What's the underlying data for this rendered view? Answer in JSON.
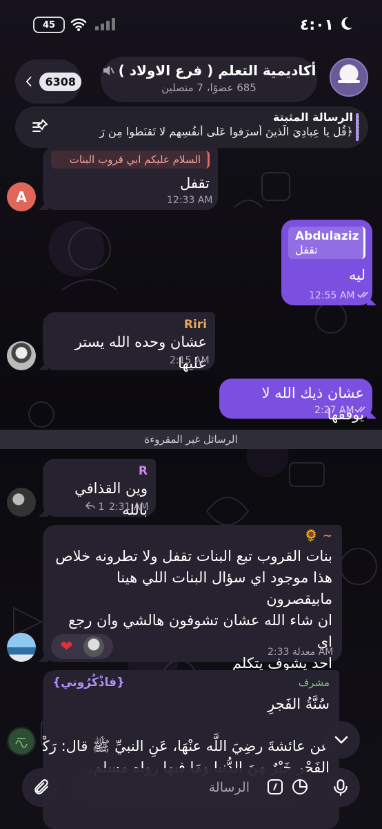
{
  "status_bar": {
    "time": "٤:٠١",
    "battery": "45"
  },
  "header": {
    "back_count": "6308",
    "title": "أكاديمية التعلم ( فرع الاولاد )",
    "subtitle": "685 عضوًا، 7 متصلين"
  },
  "pinned": {
    "label": "الرسالة المثبتة",
    "text": "﴿قُل يا عِبادِيَ الَّذينَ أَسرَفوا عَلى أَنفُسِهِم لا تَقنَطوا مِن رَ"
  },
  "messages": [
    {
      "id": "m1",
      "direction": "in",
      "avatar_letter": "A",
      "quote": "السلام عليكم ابي قروب البنات",
      "text": "تقفل",
      "time": "12:33 AM"
    },
    {
      "id": "m2",
      "direction": "out",
      "reply_name": "Abdulaziz",
      "reply_text": "تقفل",
      "text": "ليه",
      "time": "12:55 AM"
    },
    {
      "id": "m3",
      "direction": "in",
      "sender": "Riri",
      "text": "عشان وحده الله يستر عليها",
      "time": "2:15 AM"
    },
    {
      "id": "m4",
      "direction": "out",
      "text": "عشان ذيك الله لا يوفقها",
      "time": "2:27 AM"
    },
    {
      "id": "m5",
      "direction": "in",
      "sender": "R",
      "text": "وين القذافي بالله",
      "time": "2:31 AM",
      "reply_count": "1"
    },
    {
      "id": "m6",
      "direction": "in",
      "sender": "~ 🌻",
      "lines": [
        "بنات  القروب تبع البنات تقفل ولا تطرونه خلاص",
        "هذا موجود اي سؤال البنات اللي هينا مابيقصرون",
        "ان شاء الله  عشان تشوفون هالشي وان رجع اي",
        "احد يشوف يتكلم"
      ],
      "time": "معدلة 2:33 AM",
      "reaction": "❤"
    },
    {
      "id": "m7",
      "direction": "in",
      "admin": "مشرف",
      "title": "{فاذْكُرُوني}",
      "heading": "سُنَّةُ الفَجرِ",
      "lines": [
        "عن عائشةَ رضِيَ اللَّه عنْهَا، عَنِ النبيِّ ﷺ قال: رَكْعتا",
        "الفَجْرِ خَيْرٌ مِنَ الدُّنيا ومَا فيها رواه مسلم."
      ]
    }
  ],
  "unread_label": "الرسائل غير المقروءة",
  "composer": {
    "placeholder": "الرسالة"
  },
  "colors": {
    "accent": "#7b4fe0",
    "incoming": "#26222f",
    "sender_riri": "#e6a85a",
    "sender_r": "#c88be8",
    "sender_sun": "#e67a5a"
  }
}
